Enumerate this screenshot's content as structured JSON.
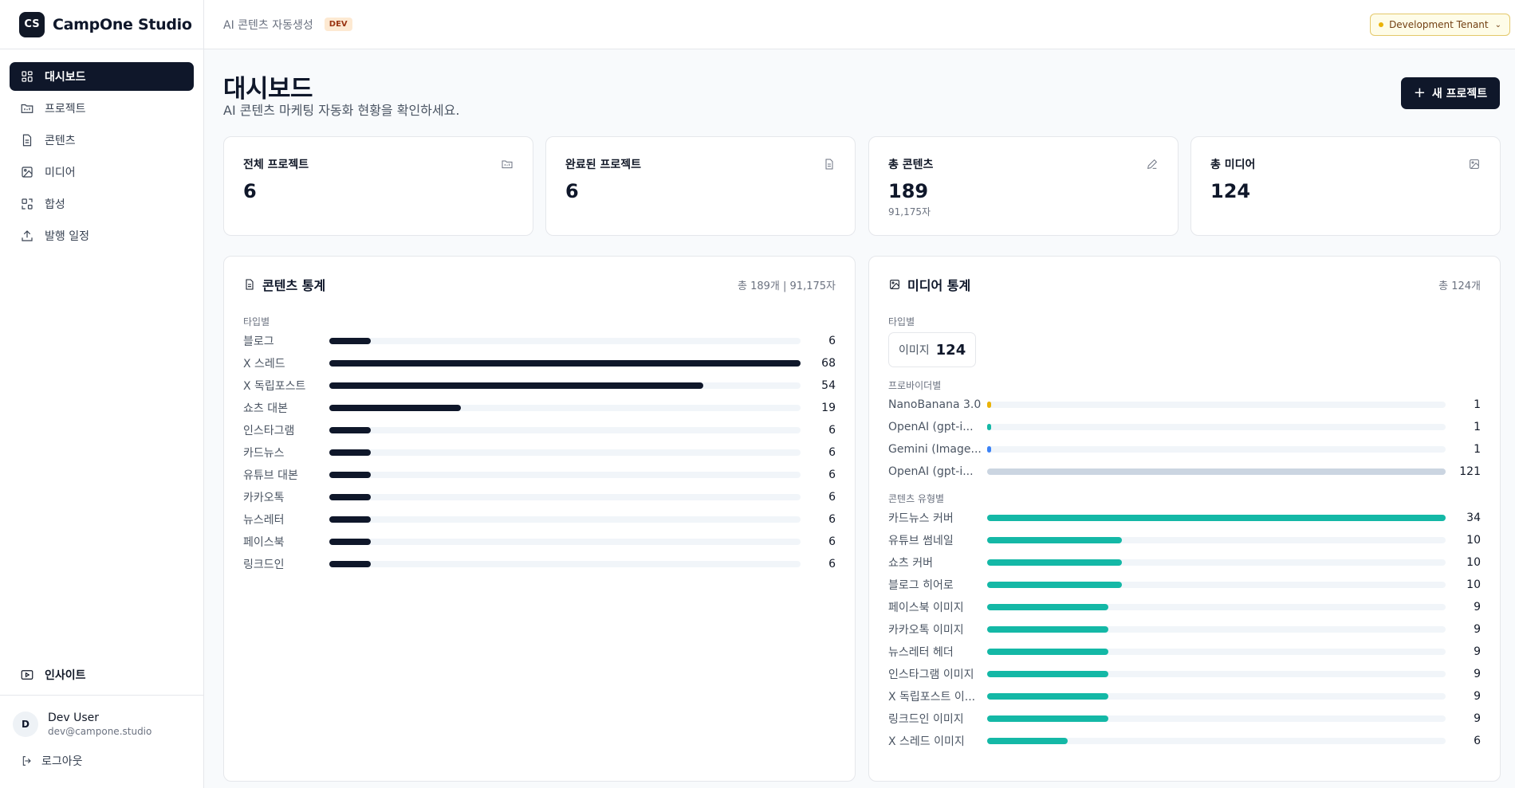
{
  "brand": {
    "logo_text": "CS",
    "name": "CampOne Studio"
  },
  "nav": [
    {
      "label": "대시보드",
      "icon": "dashboard-icon",
      "active": true
    },
    {
      "label": "프로젝트",
      "icon": "folder-icon",
      "active": false
    },
    {
      "label": "콘텐츠",
      "icon": "document-icon",
      "active": false
    },
    {
      "label": "미디어",
      "icon": "image-icon",
      "active": false
    },
    {
      "label": "합성",
      "icon": "composite-icon",
      "active": false
    },
    {
      "label": "발행 일정",
      "icon": "upload-icon",
      "active": false
    }
  ],
  "insight": {
    "label": "인사이트",
    "icon": "play-icon"
  },
  "user": {
    "initial": "D",
    "name": "Dev User",
    "email": "dev@campone.studio",
    "logout_label": "로그아웃"
  },
  "topbar": {
    "title": "AI 콘텐츠 자동생성",
    "env_badge": "DEV",
    "tenant": "Development Tenant"
  },
  "page": {
    "title": "대시보드",
    "subtitle": "AI 콘텐츠 마케팅 자동화 현황을 확인하세요.",
    "new_button": "새 프로젝트"
  },
  "stats": [
    {
      "label": "전체 프로젝트",
      "value": "6",
      "sub": "",
      "icon": "folder-icon"
    },
    {
      "label": "완료된 프로젝트",
      "value": "6",
      "sub": "",
      "icon": "document-icon"
    },
    {
      "label": "총 콘텐츠",
      "value": "189",
      "sub": "91,175자",
      "icon": "pencil-icon"
    },
    {
      "label": "총 미디어",
      "value": "124",
      "sub": "",
      "icon": "image-icon"
    }
  ],
  "colors": {
    "content_bar": "#0f172a",
    "media_bar": "#14b8a6",
    "provider_colors": [
      "#eab308",
      "#14b8a6",
      "#3b82f6",
      "#cbd5e1"
    ]
  },
  "content_stats": {
    "title": "콘텐츠 통계",
    "meta": "총 189개 | 91,175자",
    "section_label": "타입별",
    "max": 68,
    "rows": [
      {
        "label": "블로그",
        "value": 6
      },
      {
        "label": "X 스레드",
        "value": 68
      },
      {
        "label": "X 독립포스트",
        "value": 54
      },
      {
        "label": "쇼츠 대본",
        "value": 19
      },
      {
        "label": "인스타그램",
        "value": 6
      },
      {
        "label": "카드뉴스",
        "value": 6
      },
      {
        "label": "유튜브 대본",
        "value": 6
      },
      {
        "label": "카카오톡",
        "value": 6
      },
      {
        "label": "뉴스레터",
        "value": 6
      },
      {
        "label": "페이스북",
        "value": 6
      },
      {
        "label": "링크드인",
        "value": 6
      }
    ]
  },
  "media_stats": {
    "title": "미디어 통계",
    "meta": "총 124개",
    "type_label": "타입별",
    "type_chip": {
      "label": "이미지",
      "value": "124"
    },
    "provider_label": "프로바이더별",
    "provider_max": 121,
    "providers": [
      {
        "label": "NanoBanana 3.0",
        "value": 1
      },
      {
        "label": "OpenAI (gpt-i...",
        "value": 1
      },
      {
        "label": "Gemini (Image...",
        "value": 1
      },
      {
        "label": "OpenAI (gpt-i...",
        "value": 121
      }
    ],
    "content_type_label": "콘텐츠 유형별",
    "content_type_max": 34,
    "content_types": [
      {
        "label": "카드뉴스 커버",
        "value": 34
      },
      {
        "label": "유튜브 썸네일",
        "value": 10
      },
      {
        "label": "쇼츠 커버",
        "value": 10
      },
      {
        "label": "블로그 히어로",
        "value": 10
      },
      {
        "label": "페이스북 이미지",
        "value": 9
      },
      {
        "label": "카카오톡 이미지",
        "value": 9
      },
      {
        "label": "뉴스레터 헤더",
        "value": 9
      },
      {
        "label": "인스타그램 이미지",
        "value": 9
      },
      {
        "label": "X 독립포스트 이...",
        "value": 9
      },
      {
        "label": "링크드인 이미지",
        "value": 9
      },
      {
        "label": "X 스레드 이미지",
        "value": 6
      }
    ]
  }
}
